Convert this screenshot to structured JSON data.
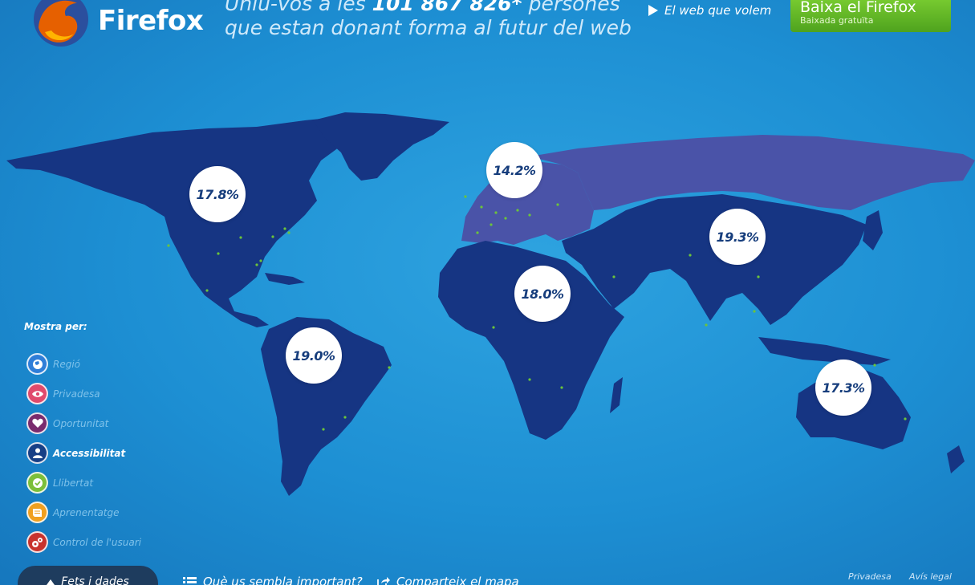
{
  "brand": {
    "name": "Firefox"
  },
  "header": {
    "headline_pre": "Uniu-vos a les ",
    "headline_count": "101 867 826*",
    "headline_post": " persones que estan donant forma al futur del web",
    "web_link": "El web que volem",
    "download_title": "Baixa el Firefox",
    "download_sub": "Baixada gratuïta"
  },
  "regions": [
    {
      "name": "north-america",
      "value": "17.8%"
    },
    {
      "name": "europe",
      "value": "14.2%"
    },
    {
      "name": "asia",
      "value": "19.3%"
    },
    {
      "name": "africa",
      "value": "18.0%"
    },
    {
      "name": "south-america",
      "value": "19.0%"
    },
    {
      "name": "oceania",
      "value": "17.3%"
    }
  ],
  "filters": {
    "title": "Mostra per:",
    "items": [
      {
        "label": "Regió",
        "icon": "globe-icon",
        "color": "#2f7ed8",
        "active": false
      },
      {
        "label": "Privadesa",
        "icon": "eye-icon",
        "color": "#e04a6c",
        "active": false
      },
      {
        "label": "Oportunitat",
        "icon": "heart-icon",
        "color": "#7a2b6e",
        "active": false
      },
      {
        "label": "Accessibilitat",
        "icon": "person-icon",
        "color": "#173f86",
        "active": true
      },
      {
        "label": "Llibertat",
        "icon": "check-icon",
        "color": "#7cbf3a",
        "active": false
      },
      {
        "label": "Aprenentatge",
        "icon": "book-icon",
        "color": "#f0a020",
        "active": false
      },
      {
        "label": "Control de l'usuari",
        "icon": "gears-icon",
        "color": "#c8322d",
        "active": false
      }
    ]
  },
  "bottom": {
    "facts_tab": "Fets i dades",
    "important_link": "Què us sembla important?",
    "share_link": "Comparteix el mapa",
    "privacy": "Privadesa",
    "legal": "Avís legal"
  },
  "colors": {
    "ocean": "#1d8fd3",
    "land_dark": "#163583",
    "land_europe": "#4a53a8",
    "accent_green": "#6cc43a"
  }
}
